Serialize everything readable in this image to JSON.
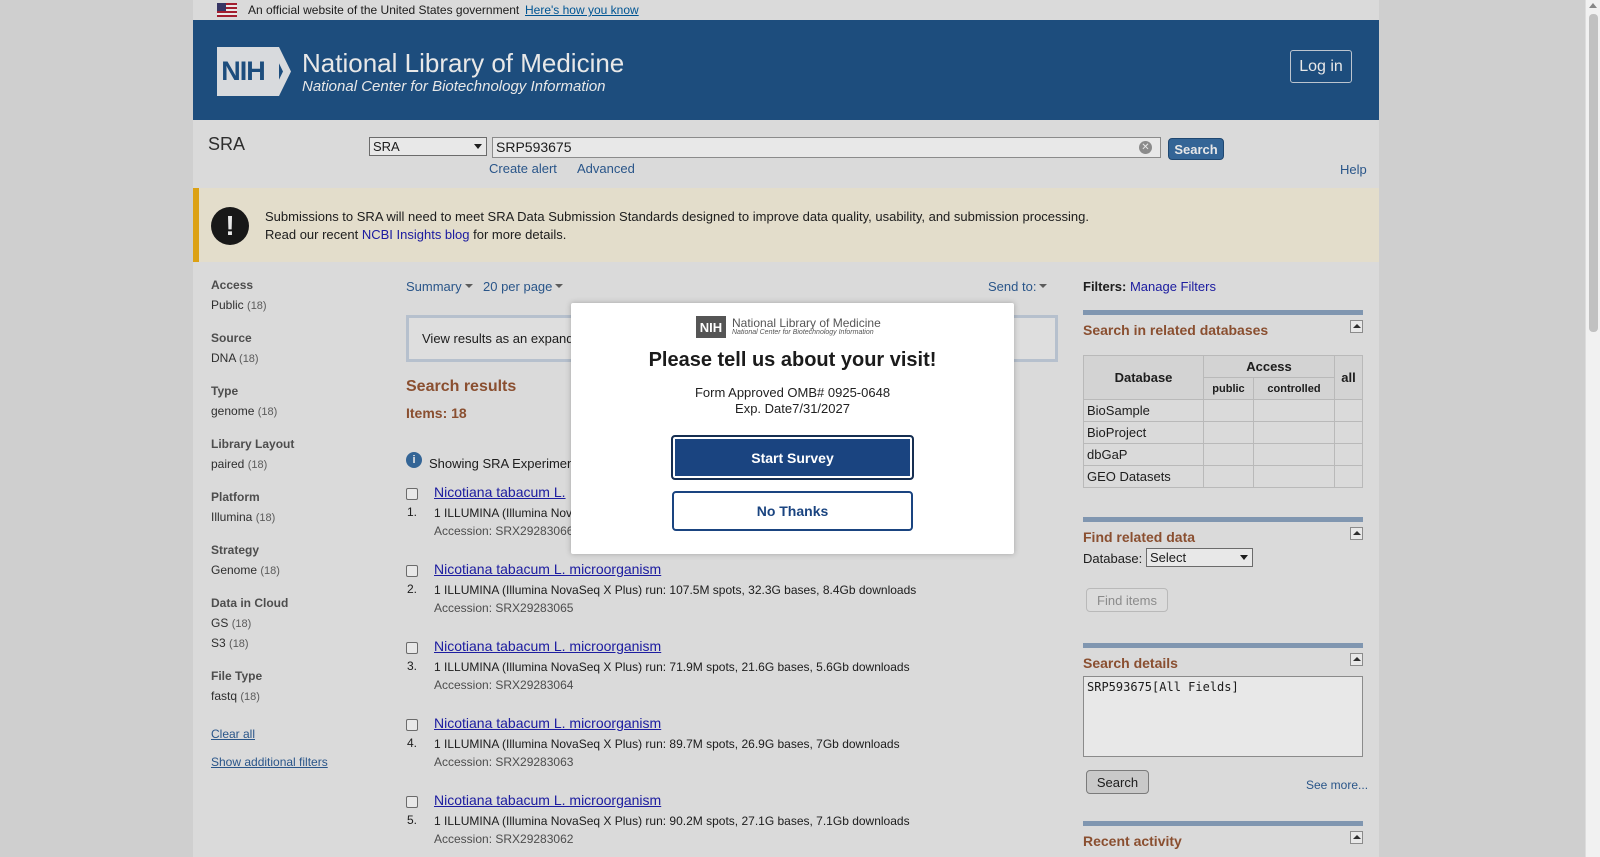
{
  "gov_banner": {
    "text": "An official website of the United States government",
    "link": "Here's how you know"
  },
  "masthead": {
    "logo": "NIH",
    "title": "National Library of Medicine",
    "subtitle": "National Center for Biotechnology Information",
    "login": "Log in"
  },
  "search": {
    "db_name": "SRA",
    "db_select": "SRA",
    "term": "SRP593675",
    "button": "Search",
    "create_alert": "Create alert",
    "advanced": "Advanced",
    "help": "Help"
  },
  "alert": {
    "line1": "Submissions to SRA will need to meet SRA Data Submission Standards designed to improve data quality, usability, and submission processing.",
    "line2_pre": "Read our recent ",
    "line2_link": "NCBI Insights blog",
    "line2_post": " for more details.",
    "icon": "!"
  },
  "facets": [
    {
      "heading": "Access",
      "values": [
        {
          "label": "Public",
          "count": "(18)"
        }
      ]
    },
    {
      "heading": "Source",
      "values": [
        {
          "label": "DNA",
          "count": "(18)"
        }
      ]
    },
    {
      "heading": "Type",
      "values": [
        {
          "label": "genome",
          "count": "(18)"
        }
      ]
    },
    {
      "heading": "Library Layout",
      "values": [
        {
          "label": "paired",
          "count": "(18)"
        }
      ]
    },
    {
      "heading": "Platform",
      "values": [
        {
          "label": "Illumina",
          "count": "(18)"
        }
      ]
    },
    {
      "heading": "Strategy",
      "values": [
        {
          "label": "Genome",
          "count": "(18)"
        }
      ]
    },
    {
      "heading": "Data in Cloud",
      "values": [
        {
          "label": "GS",
          "count": "(18)"
        },
        {
          "label": "S3",
          "count": "(18)"
        }
      ]
    },
    {
      "heading": "File Type",
      "values": [
        {
          "label": "fastq",
          "count": "(18)"
        }
      ]
    }
  ],
  "facet_links": {
    "clear_all": "Clear all",
    "show_additional": "Show additional filters"
  },
  "results": {
    "summary": "Summary",
    "per_page": "20 per page",
    "send_to": "Send to:",
    "expand_text": "View results as an expand",
    "title": "Search results",
    "items": "Items: 18",
    "showing": "Showing SRA Experimen",
    "records": [
      {
        "num": "1.",
        "title": "Nicotiana tabacum L.",
        "desc": "1 ILLUMINA (Illumina Nov",
        "acc": "Accession: SRX29283066"
      },
      {
        "num": "2.",
        "title": "Nicotiana tabacum L. microorganism",
        "desc": "1 ILLUMINA (Illumina NovaSeq X Plus) run: 107.5M spots, 32.3G bases, 8.4Gb downloads",
        "acc": "Accession: SRX29283065"
      },
      {
        "num": "3.",
        "title": "Nicotiana tabacum L. microorganism",
        "desc": "1 ILLUMINA (Illumina NovaSeq X Plus) run: 71.9M spots, 21.6G bases, 5.6Gb downloads",
        "acc": "Accession: SRX29283064"
      },
      {
        "num": "4.",
        "title": "Nicotiana tabacum L. microorganism",
        "desc": "1 ILLUMINA (Illumina NovaSeq X Plus) run: 89.7M spots, 26.9G bases, 7Gb downloads",
        "acc": "Accession: SRX29283063"
      },
      {
        "num": "5.",
        "title": "Nicotiana tabacum L. microorganism",
        "desc": "1 ILLUMINA (Illumina NovaSeq X Plus) run: 90.2M spots, 27.1G bases, 7.1Gb downloads",
        "acc": "Accession: SRX29283062"
      }
    ]
  },
  "sidebar": {
    "filters_label": "Filters:",
    "manage_filters": "Manage Filters",
    "related_title": "Search in related databases",
    "table": {
      "database": "Database",
      "access": "Access",
      "public": "public",
      "controlled": "controlled",
      "all": "all",
      "rows": [
        "BioSample",
        "BioProject",
        "dbGaP",
        "GEO Datasets"
      ]
    },
    "find_title": "Find related data",
    "database_label": "Database:",
    "database_select": "Select",
    "find_items": "Find items",
    "details_title": "Search details",
    "details_query": "SRP593675[All Fields]",
    "details_search": "Search",
    "see_more": "See more...",
    "recent_title": "Recent activity"
  },
  "modal": {
    "logo_nih": "NIH",
    "logo_title": "National Library of Medicine",
    "logo_sub": "National Center for Biotechnology Information",
    "title": "Please tell us about your visit!",
    "omb": "Form Approved OMB# 0925-0648",
    "exp": "Exp. Date7/31/2027",
    "start": "Start Survey",
    "no_thanks": "No Thanks"
  }
}
